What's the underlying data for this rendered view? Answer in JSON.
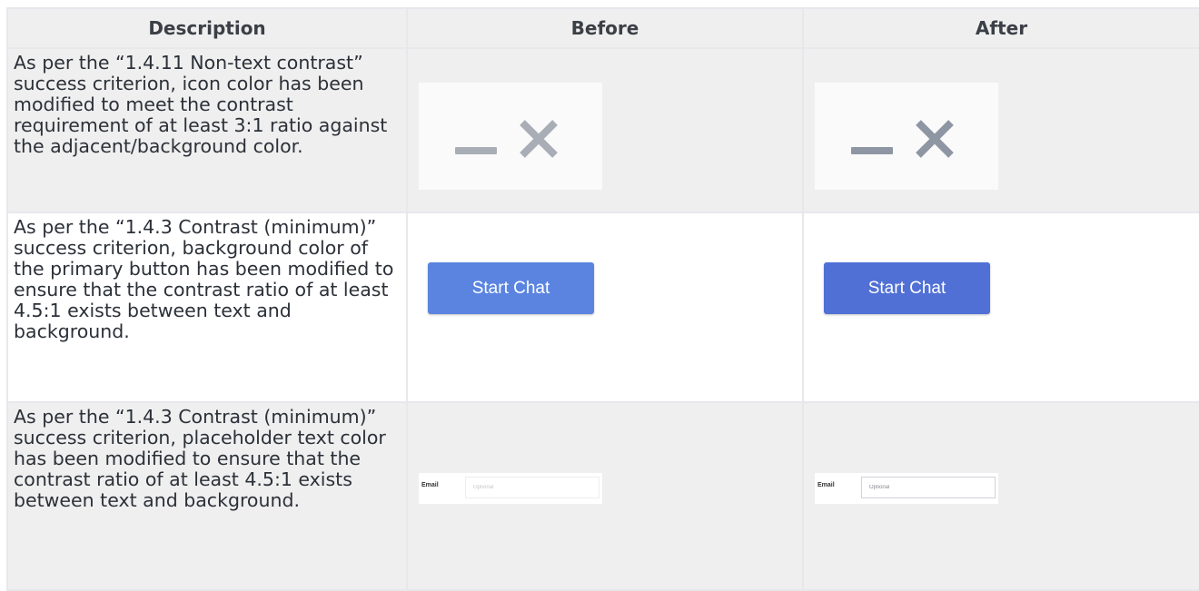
{
  "table": {
    "headers": [
      "Description",
      "Before",
      "After"
    ],
    "rows": [
      {
        "description": "As per the “1.4.11 Non-text contrast” success criterion, icon color has been modified to meet the contrast requirement of at least 3:1 ratio against the adjacent/background color.",
        "before": {
          "icons": [
            "minimize-icon",
            "close-icon"
          ],
          "icon_color": "#a8adb6"
        },
        "after": {
          "icons": [
            "minimize-icon",
            "close-icon"
          ],
          "icon_color": "#8f96a3"
        }
      },
      {
        "description": "As per the “1.4.3 Contrast (minimum)” success criterion, background color of the primary button has been modified to ensure that the contrast ratio of at least 4.5:1 exists between text and background.",
        "before": {
          "button_label": "Start Chat",
          "button_color": "#5a84e0"
        },
        "after": {
          "button_label": "Start Chat",
          "button_color": "#5070d6"
        }
      },
      {
        "description": "As per the “1.4.3 Contrast (minimum)” success criterion, placeholder text color has been modified to ensure that the contrast ratio of at least 4.5:1 exists between text and background.",
        "before": {
          "field_label": "Email",
          "placeholder": "Optional",
          "placeholder_color": "#c5c8cc",
          "border_color": "#eeeeee"
        },
        "after": {
          "field_label": "Email",
          "placeholder": "Optional",
          "placeholder_color": "#888c92",
          "border_color": "#cfd2d6"
        }
      }
    ]
  }
}
